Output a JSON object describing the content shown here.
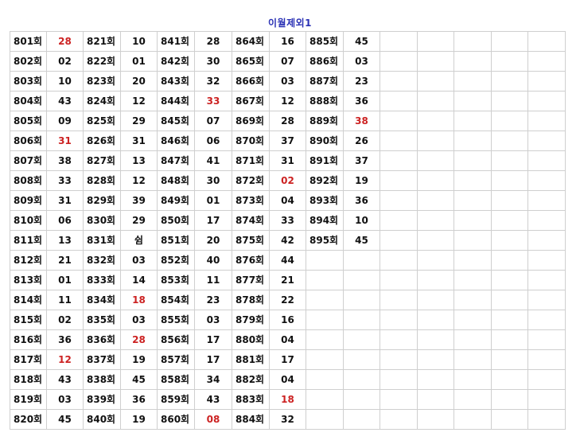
{
  "title": "이월제외1",
  "columns": [
    {
      "rows": [
        {
          "round": "801회",
          "value": "28",
          "highlight": true
        },
        {
          "round": "802회",
          "value": "02",
          "highlight": false
        },
        {
          "round": "803회",
          "value": "10",
          "highlight": false
        },
        {
          "round": "804회",
          "value": "43",
          "highlight": false
        },
        {
          "round": "805회",
          "value": "09",
          "highlight": false
        },
        {
          "round": "806회",
          "value": "31",
          "highlight": true
        },
        {
          "round": "807회",
          "value": "38",
          "highlight": false
        },
        {
          "round": "808회",
          "value": "33",
          "highlight": false
        },
        {
          "round": "809회",
          "value": "31",
          "highlight": false
        },
        {
          "round": "810회",
          "value": "06",
          "highlight": false
        },
        {
          "round": "811회",
          "value": "13",
          "highlight": false
        },
        {
          "round": "812회",
          "value": "21",
          "highlight": false
        },
        {
          "round": "813회",
          "value": "01",
          "highlight": false
        },
        {
          "round": "814회",
          "value": "11",
          "highlight": false
        },
        {
          "round": "815회",
          "value": "02",
          "highlight": false
        },
        {
          "round": "816회",
          "value": "36",
          "highlight": false
        },
        {
          "round": "817회",
          "value": "12",
          "highlight": true
        },
        {
          "round": "818회",
          "value": "43",
          "highlight": false
        },
        {
          "round": "819회",
          "value": "03",
          "highlight": false
        },
        {
          "round": "820회",
          "value": "45",
          "highlight": false
        }
      ]
    },
    {
      "rows": [
        {
          "round": "821회",
          "value": "10",
          "highlight": false
        },
        {
          "round": "822회",
          "value": "01",
          "highlight": false
        },
        {
          "round": "823회",
          "value": "20",
          "highlight": false
        },
        {
          "round": "824회",
          "value": "12",
          "highlight": false
        },
        {
          "round": "825회",
          "value": "29",
          "highlight": false
        },
        {
          "round": "826회",
          "value": "31",
          "highlight": false
        },
        {
          "round": "827회",
          "value": "13",
          "highlight": false
        },
        {
          "round": "828회",
          "value": "12",
          "highlight": false
        },
        {
          "round": "829회",
          "value": "39",
          "highlight": false
        },
        {
          "round": "830회",
          "value": "29",
          "highlight": false
        },
        {
          "round": "831회",
          "value": "쉼",
          "highlight": false
        },
        {
          "round": "832회",
          "value": "03",
          "highlight": false
        },
        {
          "round": "833회",
          "value": "14",
          "highlight": false
        },
        {
          "round": "834회",
          "value": "18",
          "highlight": true
        },
        {
          "round": "835회",
          "value": "03",
          "highlight": false
        },
        {
          "round": "836회",
          "value": "28",
          "highlight": true
        },
        {
          "round": "837회",
          "value": "19",
          "highlight": false
        },
        {
          "round": "838회",
          "value": "45",
          "highlight": false
        },
        {
          "round": "839회",
          "value": "36",
          "highlight": false
        },
        {
          "round": "840회",
          "value": "19",
          "highlight": false
        }
      ]
    },
    {
      "rows": [
        {
          "round": "841회",
          "value": "28",
          "highlight": false
        },
        {
          "round": "842회",
          "value": "30",
          "highlight": false
        },
        {
          "round": "843회",
          "value": "32",
          "highlight": false
        },
        {
          "round": "844회",
          "value": "33",
          "highlight": true
        },
        {
          "round": "845회",
          "value": "07",
          "highlight": false
        },
        {
          "round": "846회",
          "value": "06",
          "highlight": false
        },
        {
          "round": "847회",
          "value": "41",
          "highlight": false
        },
        {
          "round": "848회",
          "value": "30",
          "highlight": false
        },
        {
          "round": "849회",
          "value": "01",
          "highlight": false
        },
        {
          "round": "850회",
          "value": "17",
          "highlight": false
        },
        {
          "round": "851회",
          "value": "20",
          "highlight": false
        },
        {
          "round": "852회",
          "value": "40",
          "highlight": false
        },
        {
          "round": "853회",
          "value": "11",
          "highlight": false
        },
        {
          "round": "854회",
          "value": "23",
          "highlight": false
        },
        {
          "round": "855회",
          "value": "03",
          "highlight": false
        },
        {
          "round": "856회",
          "value": "17",
          "highlight": false
        },
        {
          "round": "857회",
          "value": "17",
          "highlight": false
        },
        {
          "round": "858회",
          "value": "34",
          "highlight": false
        },
        {
          "round": "859회",
          "value": "43",
          "highlight": false
        },
        {
          "round": "860회",
          "value": "08",
          "highlight": true
        }
      ]
    },
    {
      "rows": [
        {
          "round": "864회",
          "value": "16",
          "highlight": false
        },
        {
          "round": "865회",
          "value": "07",
          "highlight": false
        },
        {
          "round": "866회",
          "value": "03",
          "highlight": false
        },
        {
          "round": "867회",
          "value": "12",
          "highlight": false
        },
        {
          "round": "869회",
          "value": "28",
          "highlight": false
        },
        {
          "round": "870회",
          "value": "37",
          "highlight": false
        },
        {
          "round": "871회",
          "value": "31",
          "highlight": false
        },
        {
          "round": "872회",
          "value": "02",
          "highlight": true
        },
        {
          "round": "873회",
          "value": "04",
          "highlight": false
        },
        {
          "round": "874회",
          "value": "33",
          "highlight": false
        },
        {
          "round": "875회",
          "value": "42",
          "highlight": false
        },
        {
          "round": "876회",
          "value": "44",
          "highlight": false
        },
        {
          "round": "877회",
          "value": "21",
          "highlight": false
        },
        {
          "round": "878회",
          "value": "22",
          "highlight": false
        },
        {
          "round": "879회",
          "value": "16",
          "highlight": false
        },
        {
          "round": "880회",
          "value": "04",
          "highlight": false
        },
        {
          "round": "881회",
          "value": "17",
          "highlight": false
        },
        {
          "round": "882회",
          "value": "04",
          "highlight": false
        },
        {
          "round": "883회",
          "value": "18",
          "highlight": true
        },
        {
          "round": "884회",
          "value": "32",
          "highlight": false
        }
      ]
    },
    {
      "rows": [
        {
          "round": "885회",
          "value": "45",
          "highlight": false
        },
        {
          "round": "886회",
          "value": "03",
          "highlight": false
        },
        {
          "round": "887회",
          "value": "23",
          "highlight": false
        },
        {
          "round": "888회",
          "value": "36",
          "highlight": false
        },
        {
          "round": "889회",
          "value": "38",
          "highlight": true
        },
        {
          "round": "890회",
          "value": "26",
          "highlight": false
        },
        {
          "round": "891회",
          "value": "37",
          "highlight": false
        },
        {
          "round": "892회",
          "value": "19",
          "highlight": false
        },
        {
          "round": "893회",
          "value": "36",
          "highlight": false
        },
        {
          "round": "894회",
          "value": "10",
          "highlight": false
        },
        {
          "round": "895회",
          "value": "45",
          "highlight": false
        }
      ]
    }
  ],
  "colors": {
    "highlight": "#cc2222",
    "title": "#2b32b5",
    "text": "#111111",
    "border": "#cfcfcf"
  }
}
